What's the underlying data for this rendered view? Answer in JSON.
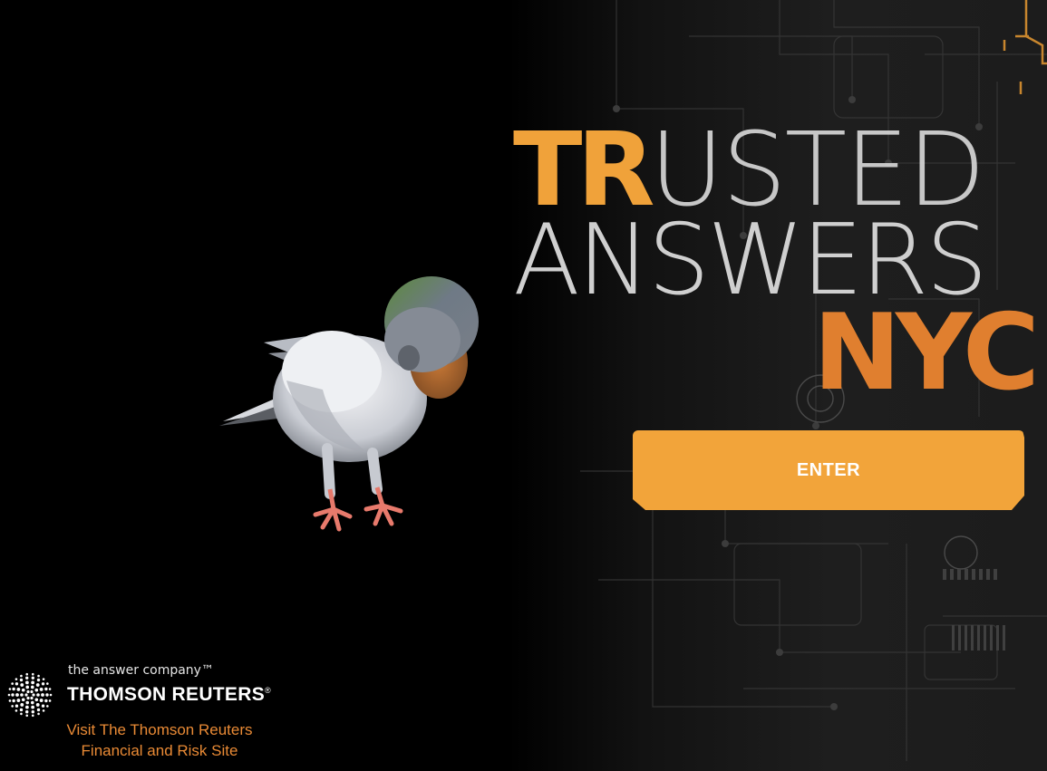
{
  "headline": {
    "line1_bold": "TR",
    "line1_thin": "USTED",
    "line2": "ANSWERS",
    "line3": "NYC"
  },
  "enter_button": {
    "label": "ENTER"
  },
  "brand": {
    "tagline": "the answer company™",
    "name": "THOMSON REUTERS",
    "registered_mark": "®",
    "visit_link_line1": "Visit The Thomson Reuters",
    "visit_link_line2": "Financial and Risk Site"
  },
  "colors": {
    "accent_orange": "#f2a43a",
    "nyc_orange": "#e07f2f",
    "link_orange": "#e98a35",
    "background": "#000000"
  },
  "icons": {
    "brand_logo": "thomson-reuters-dot-sphere-icon",
    "bird": "pigeon-illustration"
  }
}
